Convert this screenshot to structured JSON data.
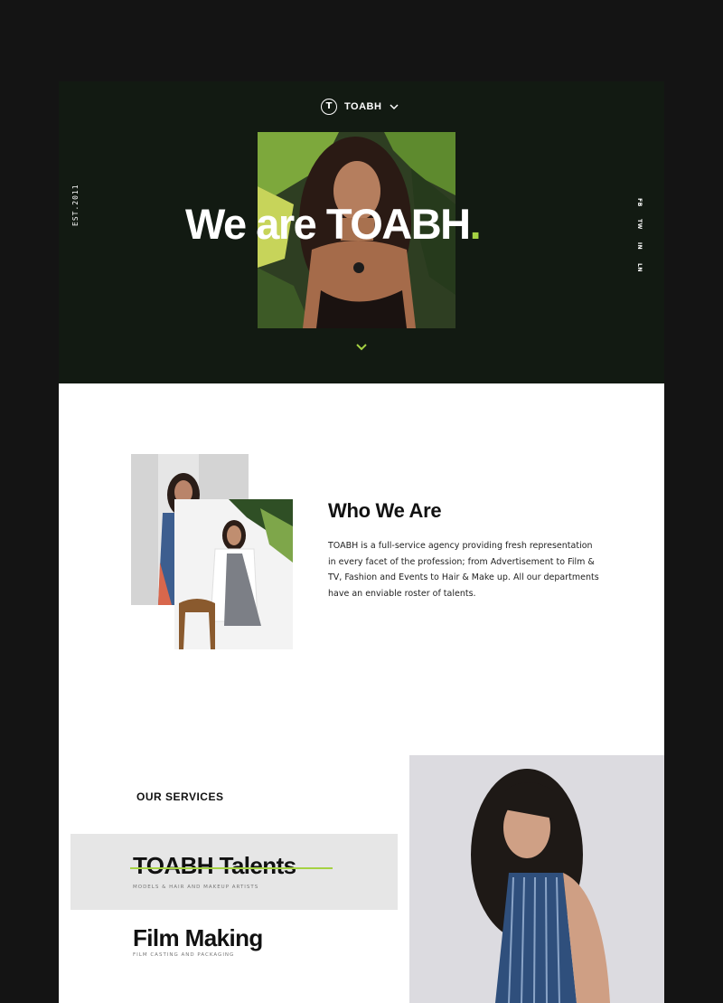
{
  "colors": {
    "accent": "#a5d243",
    "hero_bg": "#121a12",
    "page_bg": "#141414"
  },
  "header": {
    "brand_initial": "T",
    "brand_name": "TOABH",
    "menu_icon": "chevron-down-icon"
  },
  "hero": {
    "headline": "We are TOABH",
    "headline_dot": ".",
    "est": "EST.2011",
    "social": [
      "FB",
      "TW",
      "IN",
      "LN"
    ],
    "scroll_icon": "chevron-down-icon"
  },
  "who": {
    "title": "Who We Are",
    "body": "TOABH is a full-service agency providing fresh representation in every facet of the profession; from Advertisement to Film & TV, Fashion and Events to Hair & Make up. All our departments have an enviable roster of talents."
  },
  "services": {
    "label": "OUR SERVICES",
    "items": [
      {
        "title": "TOABH Talents",
        "subtitle": "MODELS & HAIR AND MAKEUP ARTISTS"
      },
      {
        "title": "Film Making",
        "subtitle": "FILM CASTING AND PACKAGING"
      }
    ]
  }
}
